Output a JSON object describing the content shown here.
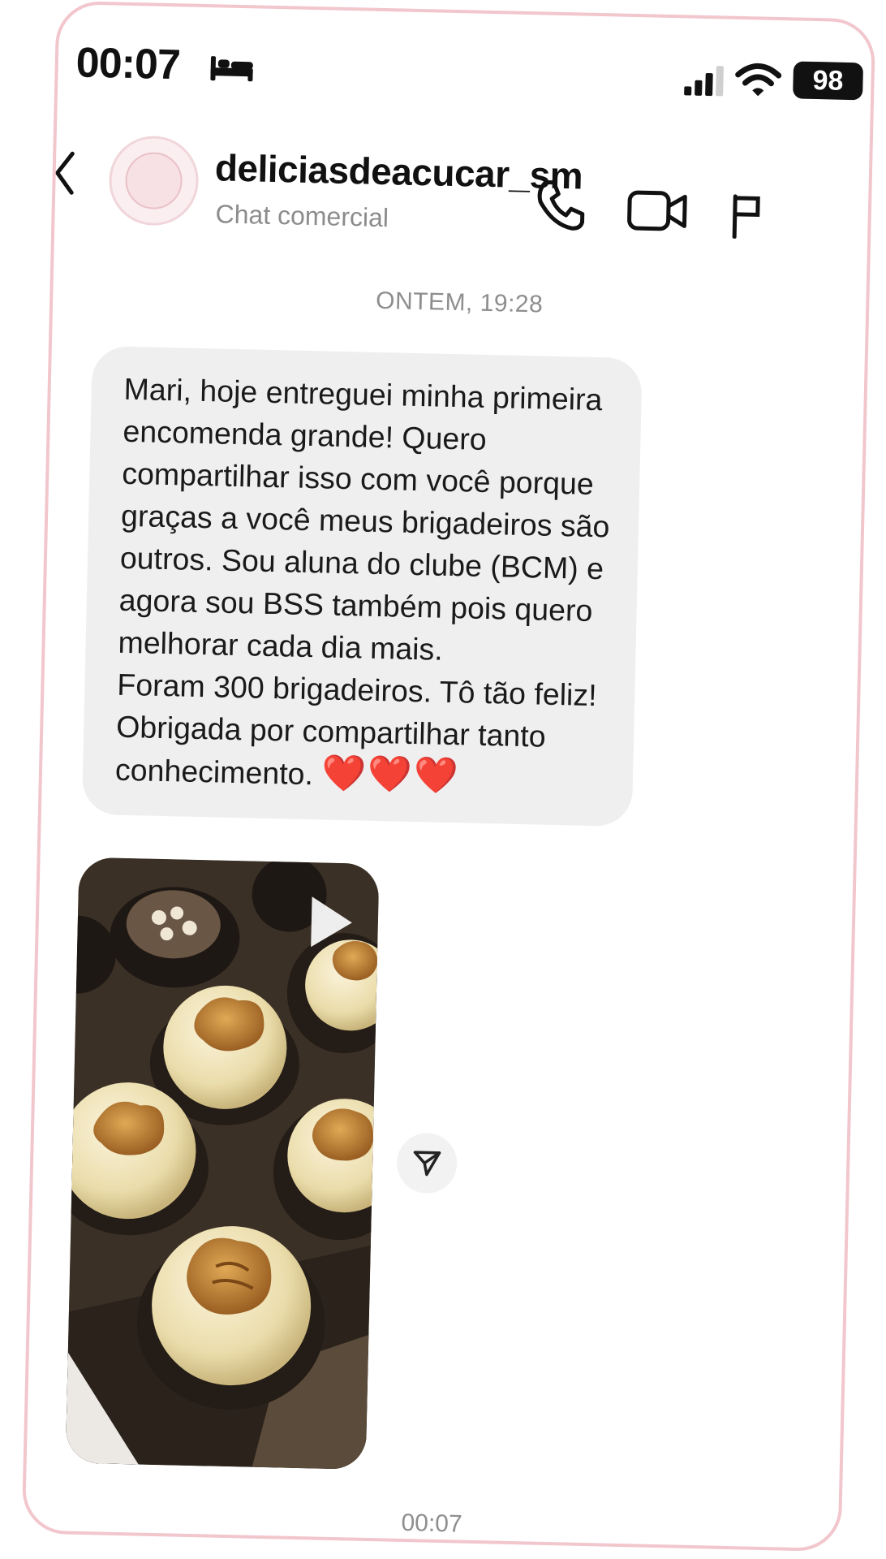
{
  "status_bar": {
    "time": "00:07",
    "battery": "98",
    "icons": [
      "bed-icon",
      "signal-icon",
      "wifi-icon",
      "battery-icon"
    ]
  },
  "header": {
    "contact_name": "deliciasdeacucar_sm",
    "subtitle": "Chat comercial",
    "icons": [
      "back-icon",
      "avatar",
      "call-icon",
      "video-icon",
      "flag-icon"
    ]
  },
  "chat": {
    "date_label": "ONTEM, 19:28",
    "message": {
      "text": "Mari, hoje entreguei minha primeira encomenda grande! Quero compartilhar isso com você porque graças a você meus brigadeiros são outros. Sou aluna do clube (BCM) e agora sou BSS também pois quero melhorar cada dia mais.\nForam 300 brigadeiros. Tô tão feliz! Obrigada por compartilhar tanto conhecimento.",
      "emoji": "❤️❤️❤️"
    },
    "attachment": {
      "type": "video",
      "icons": [
        "play-icon",
        "share-icon"
      ]
    },
    "footer_time": "00:07"
  },
  "colors": {
    "frame_border": "#f2c6cd",
    "bubble": "#efeff0",
    "muted_text": "#8e8e8e",
    "heart": "#e3252f"
  }
}
